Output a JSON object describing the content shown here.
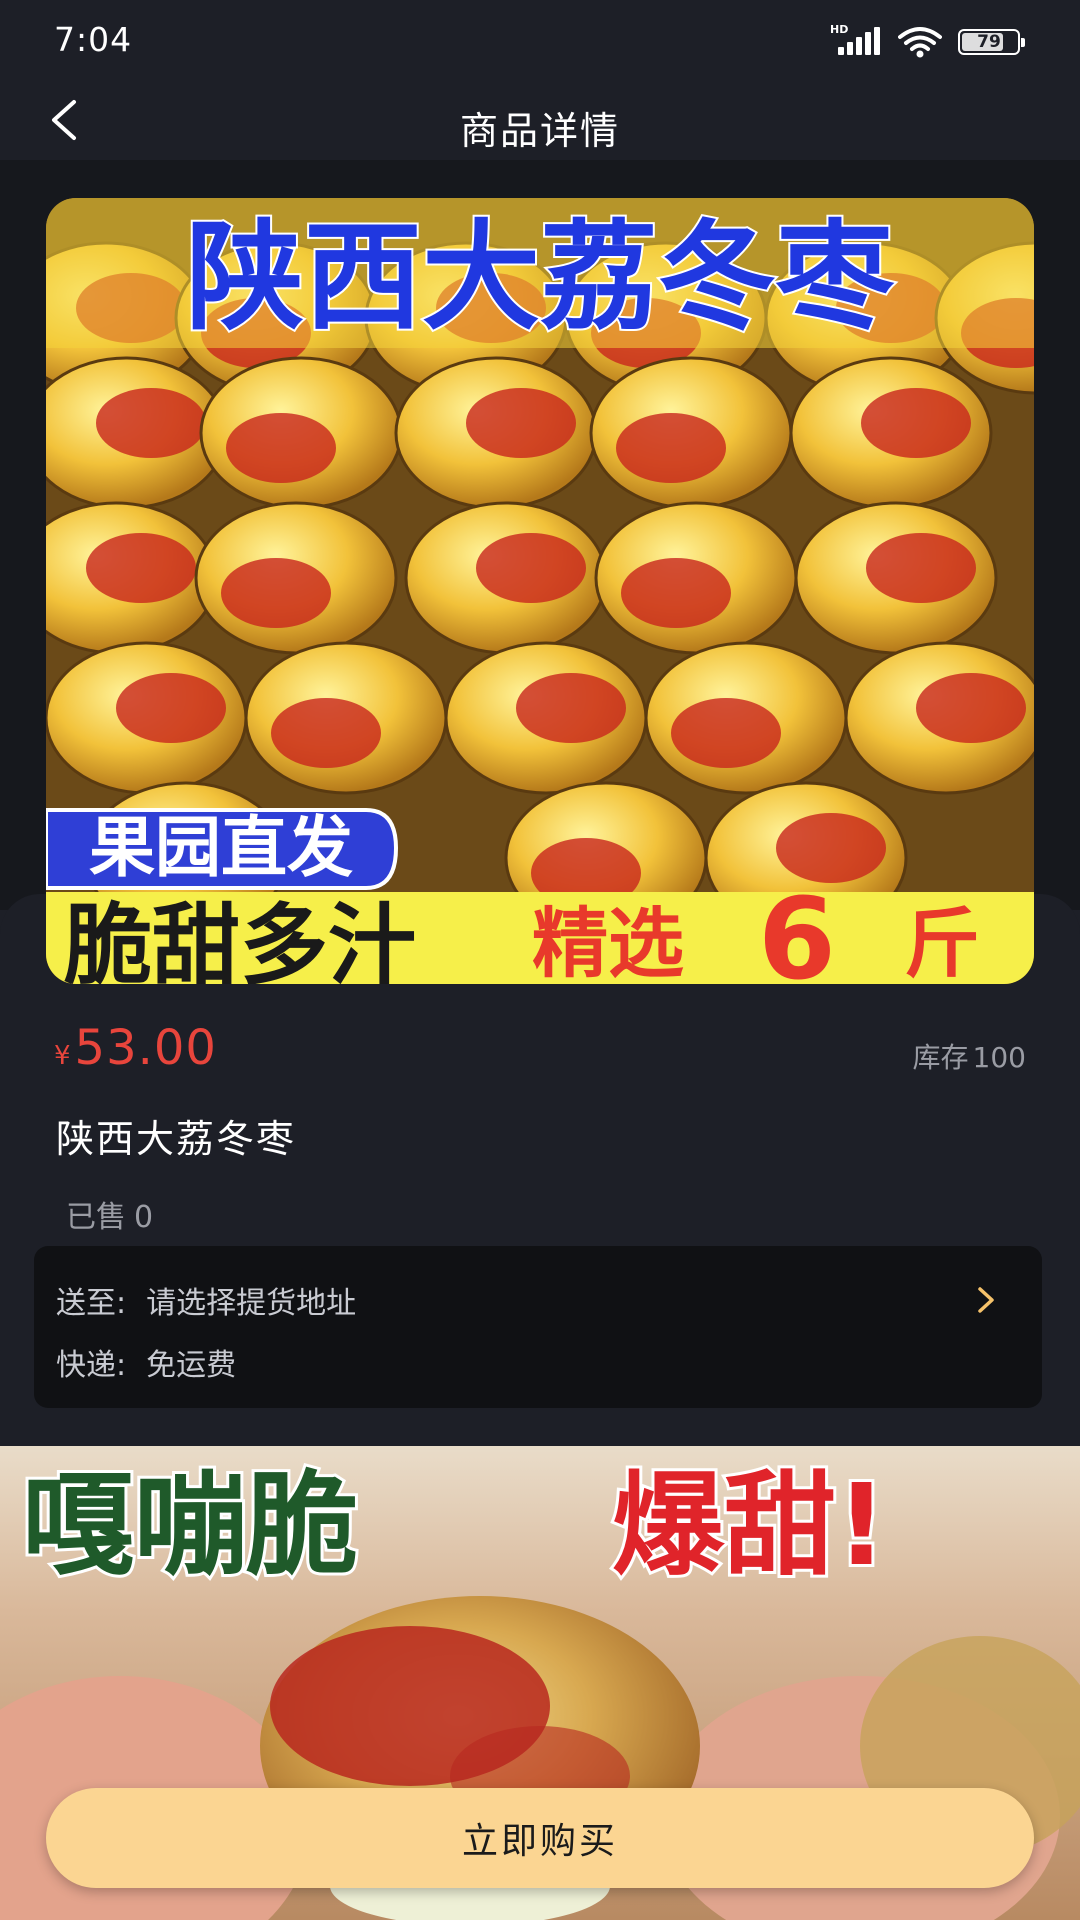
{
  "status_bar": {
    "time": "7:04",
    "network_label": "HD",
    "battery": "79",
    "battery_level": 0.79
  },
  "nav": {
    "title": "商品详情",
    "back_icon": "chevron-left-icon"
  },
  "product_image": {
    "headline": "陕西大荔冬枣",
    "badge": "果园直发",
    "tagline_left": "脆甜多汁",
    "tagline_right_prefix": "精选",
    "tagline_number": "6",
    "tagline_unit": "斤"
  },
  "product": {
    "currency": "¥",
    "price": "53.00",
    "stock_label": "库存",
    "stock_value": "100",
    "name": "陕西大荔冬枣",
    "sold_label": "已售",
    "sold_value": "0"
  },
  "delivery": {
    "ship_to_label": "送至:",
    "ship_to_value": "请选择提货地址",
    "express_label": "快递:",
    "express_value": "免运费",
    "arrow_icon": "chevron-right-icon"
  },
  "detail_image": {
    "text_left": "嘎嘣脆",
    "text_right": "爆甜!"
  },
  "buy_button": {
    "label": "立即购买"
  },
  "colors": {
    "background": "#1d1f27",
    "price": "#e8453c",
    "button": "#fbd592",
    "arrow": "#f5c26b"
  }
}
